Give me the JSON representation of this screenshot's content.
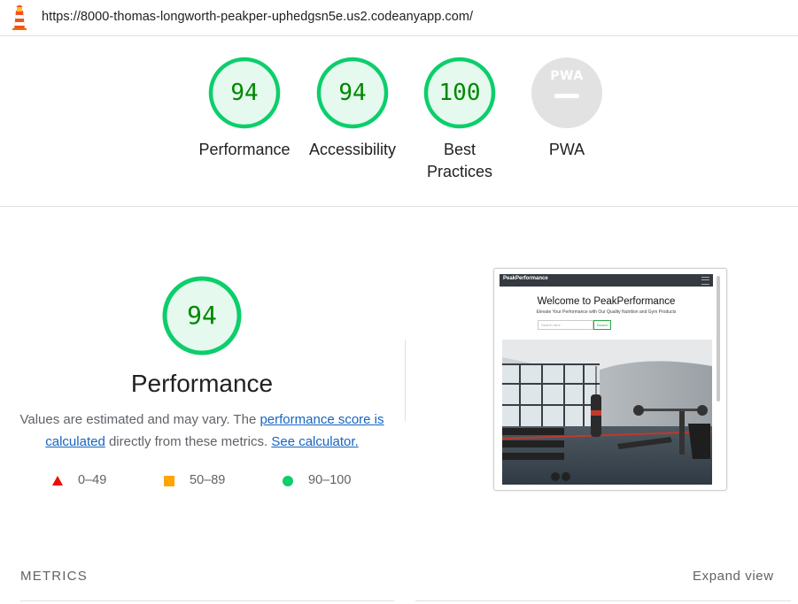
{
  "browser": {
    "url": "https://8000-thomas-longworth-peakper-uphedgsn5e.us2.codeanyapp.com/"
  },
  "summary": {
    "categories": [
      {
        "label": "Performance",
        "score": "94"
      },
      {
        "label": "Accessibility",
        "score": "94"
      },
      {
        "label": "Best Practices",
        "score": "100"
      }
    ],
    "pwa": {
      "label": "PWA",
      "badge": "PWA"
    }
  },
  "performance": {
    "score": "94",
    "title": "Performance",
    "desc_1": "Values are estimated and may vary. The ",
    "link_score": "performance score is calculated",
    "desc_2": " directly from these metrics. ",
    "link_calc": "See calculator.",
    "legend": [
      {
        "range": "0–49",
        "color": "#eb0f00"
      },
      {
        "range": "50–89",
        "color": "#ffa400"
      },
      {
        "range": "90–100",
        "color": "#0cce6b"
      }
    ]
  },
  "screenshot": {
    "brand": "PeakPerformance",
    "heading": "Welcome to PeakPerformance",
    "subtitle": "Elevate Your Performance with Our Quality Nutrition and Gym Products",
    "search_placeholder": "Search here",
    "search_button": "Search"
  },
  "metrics": {
    "heading": "METRICS",
    "expand": "Expand view"
  },
  "colors": {
    "pass": "#0cce6b",
    "pass_text": "#008800",
    "pass_fill": "#e5f9ee"
  }
}
